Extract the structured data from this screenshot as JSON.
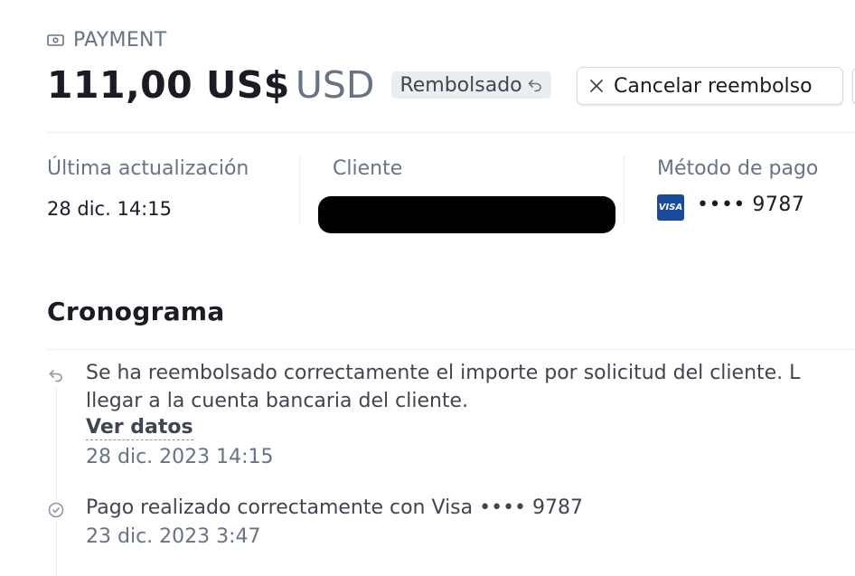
{
  "header": {
    "overline": "PAYMENT",
    "amount": "111,00 US$",
    "currency": "USD",
    "status_badge": "Rembolsado",
    "cancel_refund_label": "Cancelar reembolso"
  },
  "meta": {
    "last_update_label": "Última actualización",
    "last_update_value": "28 dic. 14:15",
    "customer_label": "Cliente",
    "payment_method_label": "Método de pago",
    "card_brand": "VISA",
    "card_masked": "•••• 9787"
  },
  "timeline": {
    "title": "Cronograma",
    "events": [
      {
        "icon": "refund-icon",
        "text_line1": "Se ha reembolsado correctamente el importe por solicitud del cliente. L",
        "text_line2": "llegar a la cuenta bancaria del cliente.",
        "link": "Ver datos",
        "date": "28 dic. 2023 14:15"
      },
      {
        "icon": "check-circle-icon",
        "text_line1": "Pago realizado correctamente con Visa •••• 9787",
        "date": "23 dic. 2023 3:47"
      }
    ]
  },
  "colors": {
    "text_primary": "#1a1b25",
    "text_secondary": "#687385",
    "badge_bg": "#ebeef1",
    "visa_blue": "#1a4a9c"
  }
}
